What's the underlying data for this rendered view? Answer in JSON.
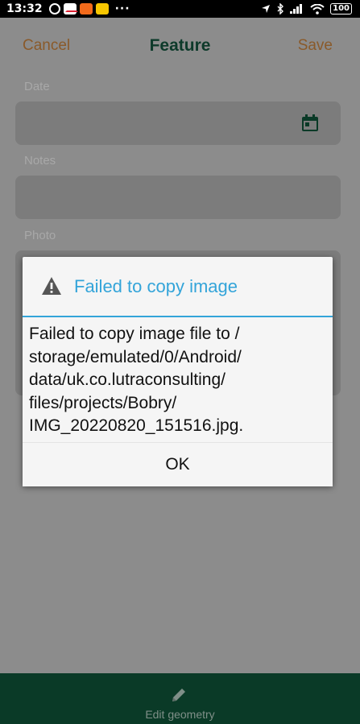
{
  "status_bar": {
    "time": "13:32",
    "more_dots": "···",
    "battery": "100"
  },
  "header": {
    "cancel_label": "Cancel",
    "title": "Feature",
    "save_label": "Save"
  },
  "form": {
    "date_label": "Date",
    "notes_label": "Notes",
    "photo_label": "Photo"
  },
  "dialog": {
    "title": "Failed to copy image",
    "message": "Failed to copy image file to /storage/emulated/0/Android/data/uk.co.lutraconsulting/files/projects/Bobry/IMG_20220820_151516.jpg.",
    "message_lines": [
      "Failed to copy image file to /",
      "storage/emulated/0/Android/",
      "data/uk.co.lutraconsulting/",
      "files/projects/Bobry/",
      "IMG_20220820_151516.jpg."
    ],
    "ok_label": "OK"
  },
  "bottom_bar": {
    "edit_geometry_label": "Edit geometry"
  },
  "colors": {
    "accent": "#33a4d9",
    "brand_dark_green": "#0a3a27",
    "cancel_save_orange": "#8a5a2a"
  },
  "icons": [
    "alarm-icon",
    "gmail-icon",
    "app-orange-icon",
    "app-yellow-icon",
    "location-icon",
    "bluetooth-icon",
    "signal-icon",
    "wifi-icon",
    "battery-icon",
    "calendar-icon",
    "warning-icon",
    "pencil-icon"
  ]
}
